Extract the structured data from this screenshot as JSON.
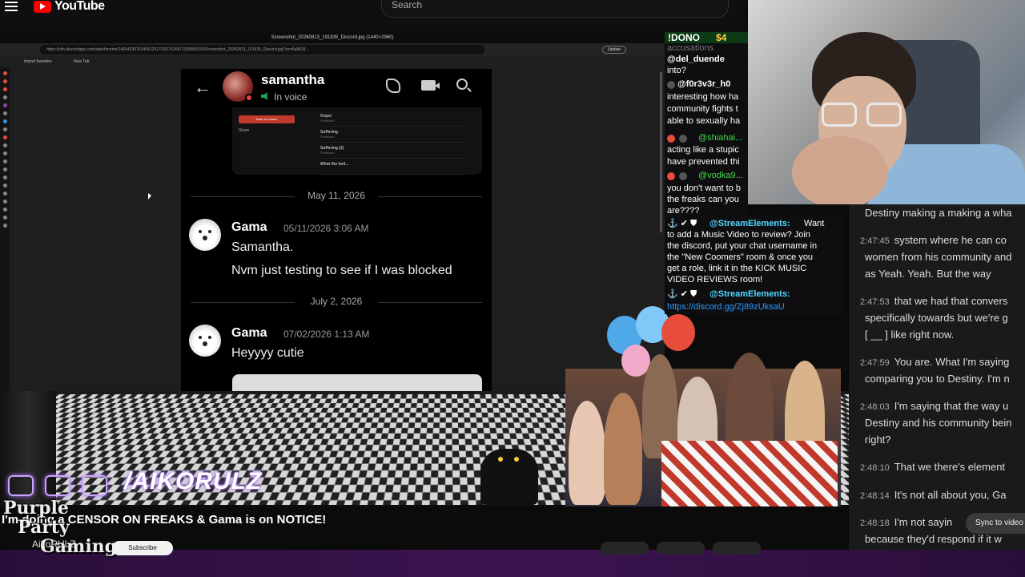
{
  "youtube": {
    "logo_text": "YouTube",
    "search_placeholder": "Search",
    "video_title": "I'm doing a CENSOR ON FREAKS & Gama is on NOTICE!",
    "channel_name": "AikoRULZ",
    "subscribe_label": "Subscribe",
    "sync_label": "Sync to video"
  },
  "browser": {
    "window_title": "Screenshot_20260813_191835_Discord.jpg (1440×2960)",
    "url": "https://cdn.discordapp.com/attachments/1466433075340412517/1527616871355855150/Screenshot_20260813_191835_Discord.jpg?ex=6a8039...",
    "update_label": "Update",
    "tabs": [
      "Import favorites",
      "New Tab"
    ]
  },
  "discord": {
    "contact_name": "samantha",
    "status": "In voice",
    "embed": {
      "button_label": "Mark as reader",
      "share_label": "Share",
      "rows": [
        {
          "title": "Oops!",
          "sub": "Published"
        },
        {
          "title": "Suffering",
          "sub": "Published"
        },
        {
          "title": "Suffering (2)",
          "sub": "Published"
        },
        {
          "title": "What the hell...",
          "sub": ""
        }
      ]
    },
    "dates": [
      "May 11, 2026",
      "July 2, 2026"
    ],
    "messages": [
      {
        "author": "Gama",
        "time": "05/11/2026 3:06 AM",
        "lines": [
          "Samantha.",
          "Nvm just testing to see if I was blocked"
        ]
      },
      {
        "author": "Gama",
        "time": "07/02/2026 1:13 AM",
        "lines": [
          "Heyyyy cutie"
        ]
      }
    ]
  },
  "overlay": {
    "handle": "/AIKORULZ",
    "logo_lines": [
      "Purple",
      "Party",
      "Gaming"
    ]
  },
  "kick_chat": {
    "dono_label": "!DONO",
    "dono_amount": "$4",
    "lines": [
      {
        "text": "accusations",
        "style": "dim"
      },
      {
        "text": "@del_duende",
        "style": "u"
      },
      {
        "text": "into?",
        "style": ""
      },
      {
        "text": "@f0r3v3r_h0",
        "style": "u"
      },
      {
        "text": "interesting how ha",
        "style": ""
      },
      {
        "text": "community fights t",
        "style": ""
      },
      {
        "text": "able to sexually ha",
        "style": ""
      },
      {
        "text": "@shiahai...",
        "style": "g"
      },
      {
        "text": "acting like a stupic",
        "style": ""
      },
      {
        "text": "have prevented thi",
        "style": ""
      },
      {
        "text": "@vodka9...",
        "style": "g"
      },
      {
        "text": "you don't want to b",
        "style": ""
      },
      {
        "text": "the freaks can you",
        "style": ""
      },
      {
        "text": "are????",
        "style": ""
      }
    ],
    "stream_elements": {
      "user": "@StreamElements:",
      "message_lines": [
        "Want",
        "to add a Music Video to review? Join",
        "the discord, put your chat username in",
        "the \"New Coomers\" room & once you",
        "get a role, link it in the KICK MUSIC",
        "VIDEO REVIEWS room!"
      ],
      "link": "https://discord.gg/Zj89zUksaU"
    }
  },
  "transcript": [
    {
      "time": "",
      "text": "Destiny making a making a wha"
    },
    {
      "time": "2:47:45",
      "text": "system where he can co"
    },
    {
      "time": "",
      "text": "women from his community and"
    },
    {
      "time": "",
      "text": "as Yeah. Yeah. But the way"
    },
    {
      "time": "2:47:53",
      "text": "that we had that convers"
    },
    {
      "time": "",
      "text": "specifically towards but we're g"
    },
    {
      "time": "",
      "text": "[ __ ] like right now."
    },
    {
      "time": "2:47:59",
      "text": "You are. What I'm saying"
    },
    {
      "time": "",
      "text": "comparing you to Destiny. I'm n"
    },
    {
      "time": "2:48:03",
      "text": "I'm saying that the way u"
    },
    {
      "time": "",
      "text": "Destiny and his community bein"
    },
    {
      "time": "",
      "text": "right?"
    },
    {
      "time": "2:48:10",
      "text": "That we there's element"
    },
    {
      "time": "2:48:14",
      "text": "It's not all about you, Ga"
    },
    {
      "time": "2:48:18",
      "text": "I'm not sayin"
    },
    {
      "time": "",
      "text": "because they'd respond if it w"
    }
  ],
  "colors": {
    "youtube_red": "#ff0000",
    "discord_voice_green": "#23a55a",
    "kick_green": "#43d64b",
    "neon_purple": "#b07cff",
    "stream_elements_blue": "#53d7ff"
  }
}
